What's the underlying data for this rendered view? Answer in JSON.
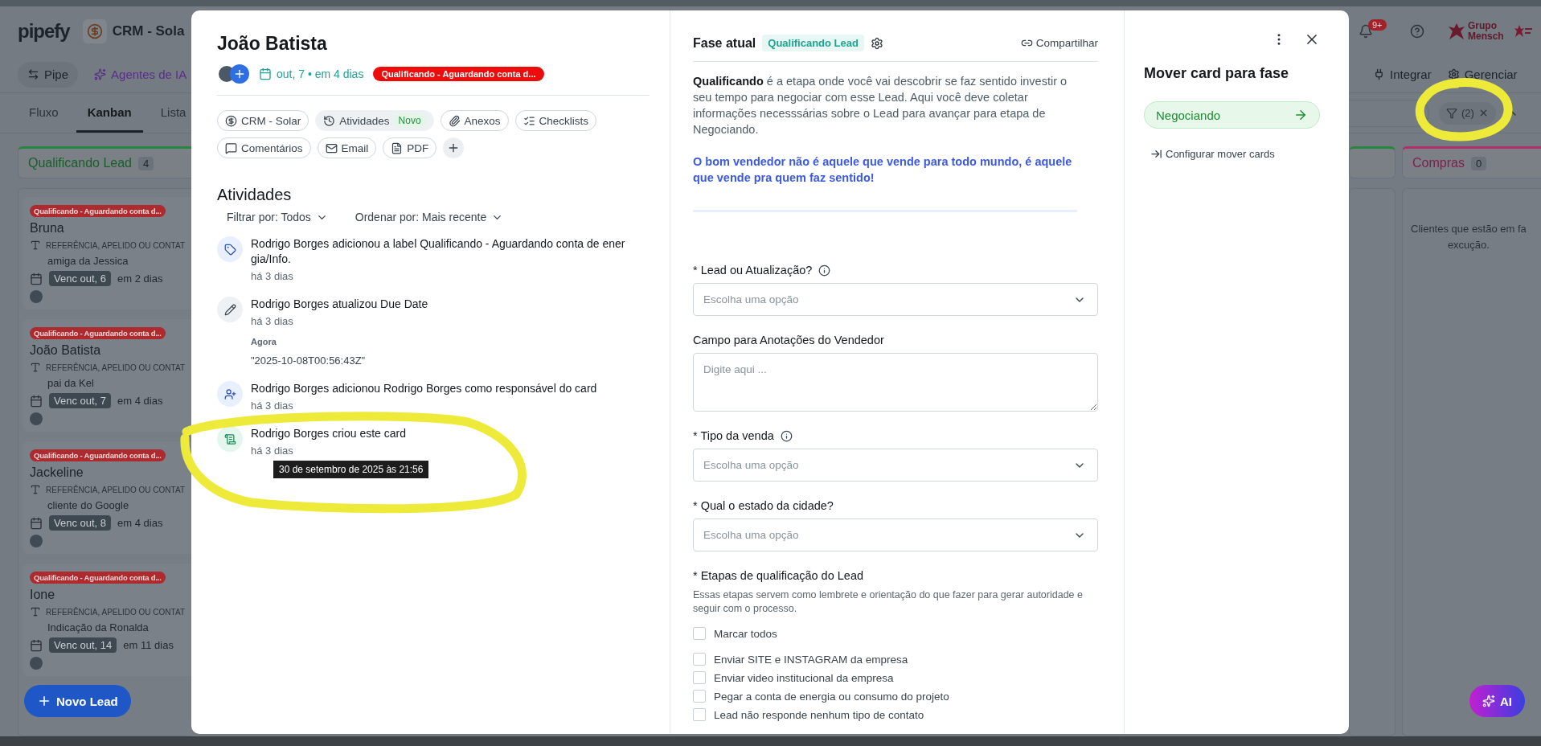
{
  "app": {
    "logo": "pipefy",
    "pipe_name": "CRM - Sola",
    "pipe_button": "Pipe",
    "agents_button": "Agentes de IA",
    "notifications": "9+",
    "brand": "Grupo Mensch",
    "actions": [
      "Integrar",
      "Gerenciar"
    ]
  },
  "view_tabs": [
    {
      "label": "Fluxo",
      "selected": false
    },
    {
      "label": "Kanban",
      "selected": true
    },
    {
      "label": "Lista",
      "selected": false
    }
  ],
  "filter_chip": {
    "count": "(2)"
  },
  "phases": [
    {
      "title": "Qualificando Lead",
      "count": "4",
      "color": "#27853f",
      "cards": [
        {
          "tag": "Qualificando - Aguardando conta d...",
          "title": "Bruna",
          "field_label": "REFERÊNCIA, APELIDO OU CONTAT",
          "field_value": "amiga da Jessica",
          "due": "Venc out, 6",
          "due_relative": "em 2 dias"
        },
        {
          "tag": "Qualificando - Aguardando conta d...",
          "title": "João Batista",
          "field_label": "REFERÊNCIA, APELIDO OU CONTAT",
          "field_value": "pai da Kel",
          "due": "Venc out, 7",
          "due_relative": "em 4 dias"
        },
        {
          "tag": "Qualificando - Aguardando conta d...",
          "title": "Jackeline",
          "field_label": "REFERÊNCIA, APELIDO OU CONTAT",
          "field_value": "cliente do Google",
          "due": "Venc out, 8",
          "due_relative": "em 4 dias"
        },
        {
          "tag": "Qualificando - Aguardando conta d...",
          "title": "Ione",
          "field_label": "REFERÊNCIA, APELIDO OU CONTAT",
          "field_value": "Indicação da Ronalda",
          "due": "Venc out, 14",
          "due_relative": "em 11 dias"
        }
      ]
    },
    {
      "color": "#27853f"
    },
    {
      "title": "Compras",
      "count": "0",
      "color": "#b0306a",
      "empty_lines": [
        "Clientes que estão em fa",
        "excução."
      ]
    }
  ],
  "new_card_button": "Novo Lead",
  "ai_button": "AI",
  "card": {
    "title": "João Batista",
    "due": "out, 7 • em 4 dias",
    "label": "Qualificando - Aguardando conta d...",
    "sections": [
      {
        "kind": "pipe",
        "label": "CRM - Solar",
        "selected": false
      },
      {
        "kind": "activities",
        "label": "Atividades",
        "badge": "Novo",
        "selected": true
      },
      {
        "kind": "attachments",
        "label": "Anexos",
        "selected": false
      },
      {
        "kind": "checklists",
        "label": "Checklists",
        "selected": false
      },
      {
        "kind": "comments",
        "label": "Comentários",
        "selected": false
      },
      {
        "kind": "email",
        "label": "Email",
        "selected": false
      },
      {
        "kind": "pdf",
        "label": "PDF",
        "selected": false
      }
    ]
  },
  "activities": {
    "title": "Atividades",
    "filter": "Filtrar por: Todos",
    "sort": "Ordenar por: Mais recente",
    "items": [
      {
        "kind": "label",
        "text": "Rodrigo Borges adicionou a label Qualificando - Aguardando conta de energia/Info.",
        "time": "há 3 dias"
      },
      {
        "kind": "edit",
        "text": "Rodrigo Borges atualizou Due Date",
        "time": "há 3 dias",
        "detail_label": "Agora",
        "detail_value": "\"2025-10-08T00:56:43Z\""
      },
      {
        "kind": "assignee",
        "text": "Rodrigo Borges adicionou Rodrigo Borges como responsável do card",
        "time": "há 3 dias"
      },
      {
        "kind": "created",
        "text": "Rodrigo Borges criou este card",
        "time": "há 3 dias",
        "tooltip": "30 de setembro de 2025 às 21:56"
      }
    ]
  },
  "phase_panel": {
    "title": "Fase atual",
    "phase": "Qualificando Lead",
    "share": "Compartilhar",
    "description": "**Qualificando** é a etapa onde você vai descobrir se faz sentido investir o seu tempo para negociar com esse Lead. Aqui você deve coletar informações necesssárias sobre o Lead para avançar para etapa de Negociando.",
    "motto": "O bom vendedor não é aquele que vende para todo mundo, é aquele que vende pra quem faz sentido!",
    "fields": [
      {
        "kind": "select",
        "label": "* Lead ou Atualização?",
        "info": true,
        "placeholder": "Escolha uma opção"
      },
      {
        "kind": "textarea",
        "label": "Campo para Anotações do Vendedor",
        "info": false,
        "placeholder": "Digite aqui ..."
      },
      {
        "kind": "select",
        "label": "* Tipo da venda",
        "info": true,
        "placeholder": "Escolha uma opção"
      },
      {
        "kind": "select",
        "label": "* Qual o estado da cidade?",
        "info": false,
        "placeholder": "Escolha uma opção"
      },
      {
        "kind": "checklist",
        "label": "* Etapas de qualificação do Lead",
        "info": false,
        "help": "Essas etapas servem como lembrete e orientação do que fazer para gerar autoridade e seguir com o processo.",
        "select_all": {
          "label": "Marcar todos",
          "checked": false
        },
        "options": [
          {
            "label": "Enviar SITE e INSTAGRAM da empresa",
            "checked": false
          },
          {
            "label": "Enviar video institucional da empresa",
            "checked": false
          },
          {
            "label": "Pegar a conta de energia ou consumo do projeto",
            "checked": false
          },
          {
            "label": "Lead não responde nenhum tipo de contato",
            "checked": false
          }
        ]
      }
    ]
  },
  "move_panel": {
    "title": "Mover card para fase",
    "targets": [
      {
        "label": "Negociando"
      }
    ],
    "configure": "Configurar mover cards"
  },
  "annotations": [
    {
      "kind": "filter-ring",
      "color": "#eeea3a"
    },
    {
      "kind": "activity-ring",
      "color": "#eeea3a"
    }
  ]
}
